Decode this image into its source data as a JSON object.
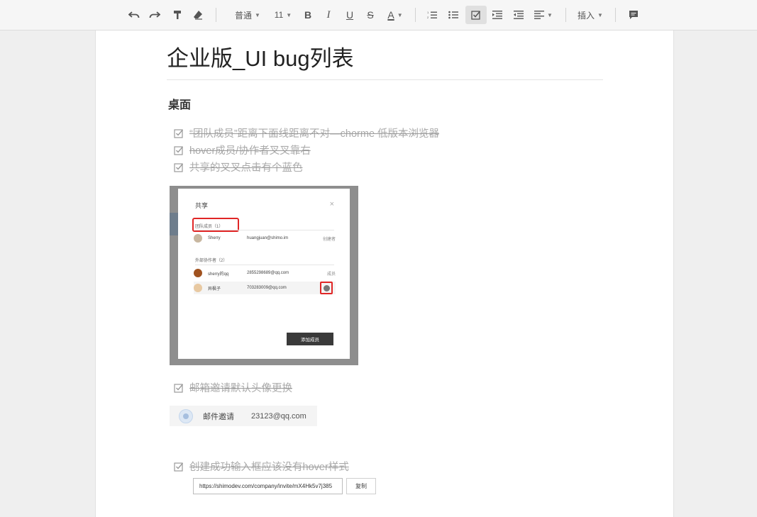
{
  "toolbar": {
    "style_select": "普通",
    "font_size_select": "11",
    "bold": "B",
    "italic": "I",
    "underline": "U",
    "strike": "S",
    "font_color": "A",
    "insert_label": "插入"
  },
  "doc": {
    "title": "企业版_UI bug列表",
    "section_heading": "桌面",
    "todos": [
      "“团队成员”距离下面线距离不对—chorme 低版本浏览器",
      "hover成员/协作者叉叉靠右",
      "共享的叉叉点击有个蓝色",
      "邮箱邀请默认头像更换",
      "创建成功输入框应该没有hover样式"
    ]
  },
  "share_dialog": {
    "title": "共享",
    "close": "×",
    "team_section": "团队成员（1）",
    "team_members": [
      {
        "name": "Sherry",
        "email": "huangjuan@shimo.im",
        "role": "创建者"
      }
    ],
    "external_section": "外部协作者（2）",
    "external_members": [
      {
        "name": "sherry的qq",
        "email": "2855298689@qq.com",
        "role": "成员"
      },
      {
        "name": "异枫子",
        "email": "703283009@qq.com",
        "role": ""
      }
    ],
    "add_button": "添加成员"
  },
  "email_invite": {
    "label": "邮件邀请",
    "email": "23123@qq.com"
  },
  "invite_link": {
    "url": "https://shimodev.com/company/invite/mX4Hk5v7j385",
    "copy_label": "复制"
  },
  "colors": {
    "highlight": "#e02626",
    "page_bg": "#efefef"
  }
}
